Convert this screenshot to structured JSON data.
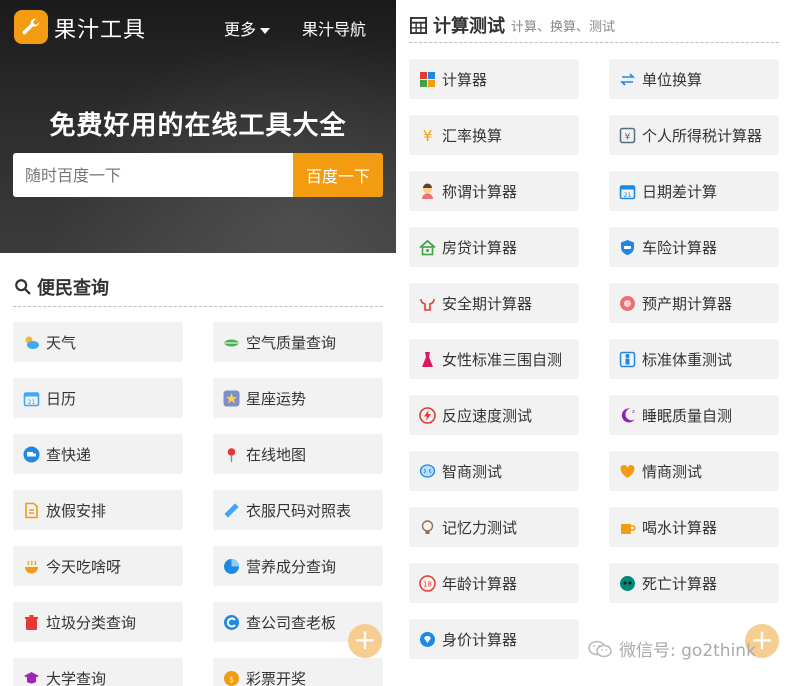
{
  "header": {
    "brand": "果汁工具",
    "more_label": "更多",
    "nav_label": "果汁导航",
    "slogan": "免费好用的在线工具大全"
  },
  "search": {
    "placeholder": "随时百度一下",
    "button": "百度一下"
  },
  "section_left": {
    "title": "便民查询",
    "icon": "search-icon",
    "items": [
      {
        "label": "天气",
        "icon": "weather-icon",
        "color": "#3fa9f5"
      },
      {
        "label": "空气质量查询",
        "icon": "leaf-icon",
        "color": "#4caf50"
      },
      {
        "label": "日历",
        "icon": "calendar-icon",
        "color": "#3fa9f5"
      },
      {
        "label": "星座运势",
        "icon": "star-icon",
        "color": "#7e8ec9"
      },
      {
        "label": "查快递",
        "icon": "truck-icon",
        "color": "#1e88e5"
      },
      {
        "label": "在线地图",
        "icon": "map-pin-icon",
        "color": "#e53935"
      },
      {
        "label": "放假安排",
        "icon": "document-icon",
        "color": "#f39c12"
      },
      {
        "label": "衣服尺码对照表",
        "icon": "ruler-icon",
        "color": "#42a5f5"
      },
      {
        "label": "今天吃啥呀",
        "icon": "food-icon",
        "color": "#f39c12"
      },
      {
        "label": "营养成分查询",
        "icon": "pie-icon",
        "color": "#1e88e5"
      },
      {
        "label": "垃圾分类查询",
        "icon": "trash-icon",
        "color": "#e53935"
      },
      {
        "label": "查公司查老板",
        "icon": "company-icon",
        "color": "#1e88e5"
      },
      {
        "label": "大学查询",
        "icon": "graduation-icon",
        "color": "#9c27b0"
      },
      {
        "label": "彩票开奖",
        "icon": "lottery-icon",
        "color": "#f39c12"
      }
    ]
  },
  "section_right": {
    "title": "计算测试",
    "subtitle": "计算、换算、测试",
    "icon": "calculator-grid-icon",
    "items": [
      {
        "label": "计算器",
        "icon": "calculator-icon",
        "color": "#e53935"
      },
      {
        "label": "单位换算",
        "icon": "swap-icon",
        "color": "#1e88e5"
      },
      {
        "label": "汇率换算",
        "icon": "yen-icon",
        "color": "#f39c12"
      },
      {
        "label": "个人所得税计算器",
        "icon": "tax-icon",
        "color": "#546e7a"
      },
      {
        "label": "称谓计算器",
        "icon": "person-icon",
        "color": "#e57373"
      },
      {
        "label": "日期差计算",
        "icon": "calendar-icon",
        "color": "#1e88e5"
      },
      {
        "label": "房贷计算器",
        "icon": "house-icon",
        "color": "#43a047"
      },
      {
        "label": "车险计算器",
        "icon": "car-insurance-icon",
        "color": "#1e88e5"
      },
      {
        "label": "安全期计算器",
        "icon": "uterus-icon",
        "color": "#e53935"
      },
      {
        "label": "预产期计算器",
        "icon": "baby-icon",
        "color": "#e57373"
      },
      {
        "label": "女性标准三围自测",
        "icon": "dress-icon",
        "color": "#d81b60"
      },
      {
        "label": "标准体重测试",
        "icon": "scale-icon",
        "color": "#1e88e5"
      },
      {
        "label": "反应速度测试",
        "icon": "lightning-icon",
        "color": "#e53935"
      },
      {
        "label": "睡眠质量自测",
        "icon": "moon-icon",
        "color": "#8e24aa"
      },
      {
        "label": "智商测试",
        "icon": "brain-icon",
        "color": "#1e88e5"
      },
      {
        "label": "情商测试",
        "icon": "heart-icon",
        "color": "#f39c12"
      },
      {
        "label": "记忆力测试",
        "icon": "bulb-icon",
        "color": "#8d6e63"
      },
      {
        "label": "喝水计算器",
        "icon": "cup-icon",
        "color": "#f39c12"
      },
      {
        "label": "年龄计算器",
        "icon": "age-icon",
        "color": "#e53935"
      },
      {
        "label": "死亡计算器",
        "icon": "skull-icon",
        "color": "#00897b"
      },
      {
        "label": "身价计算器",
        "icon": "diamond-icon",
        "color": "#1e88e5"
      }
    ]
  },
  "watermark": "微信号: go2think",
  "accent": "#f39c12"
}
